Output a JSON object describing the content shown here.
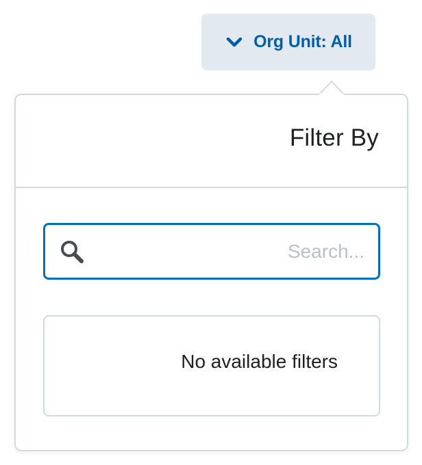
{
  "opener": {
    "label": "Org Unit: All",
    "icon": "chevron-down-icon"
  },
  "popover": {
    "title": "Filter By",
    "search": {
      "value": "",
      "placeholder": "...Search",
      "icon": "search-icon"
    },
    "empty_message": "No available filters"
  },
  "colors": {
    "accent": "#006fbf",
    "opener_background": "#e3e9f1",
    "opener_text": "#005fa8",
    "border": "#d3d9e3",
    "placeholder": "#b8c0ca",
    "text": "#202122"
  }
}
